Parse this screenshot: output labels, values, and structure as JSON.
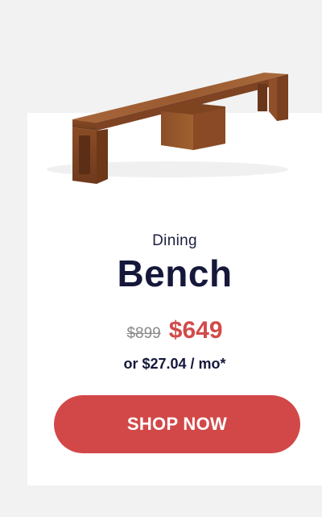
{
  "product": {
    "image_icon": "bench-image",
    "category": "Dining",
    "title": "Bench",
    "old_price": "$899",
    "new_price": "$649",
    "monthly": "or $27.04 / mo*",
    "cta_label": "SHOP NOW"
  },
  "colors": {
    "background": "#f2f2f2",
    "card": "#ffffff",
    "accent": "#d24848",
    "price": "#d24a4a",
    "text": "#15183a"
  }
}
